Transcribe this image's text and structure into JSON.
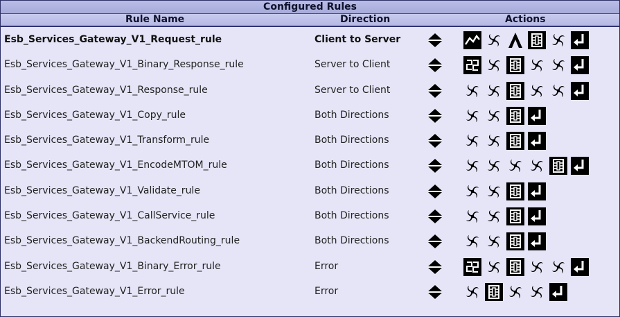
{
  "title": "Configured Rules",
  "headers": {
    "rule_name": "Rule Name",
    "direction": "Direction",
    "actions": "Actions"
  },
  "rules": [
    {
      "name": "Esb_Services_Gateway_V1_Request_rule",
      "direction": "Client to Server",
      "bold": true,
      "actions": [
        "filter-icon",
        "transform-icon",
        "validate-icon",
        "route-icon",
        "transform-icon",
        "result-icon"
      ]
    },
    {
      "name": "Esb_Services_Gateway_V1_Binary_Response_rule",
      "direction": "Server to Client",
      "bold": false,
      "actions": [
        "binary-transform-icon",
        "transform-icon",
        "route-icon",
        "transform-icon",
        "transform-icon",
        "result-icon"
      ]
    },
    {
      "name": "Esb_Services_Gateway_V1_Response_rule",
      "direction": "Server to Client",
      "bold": false,
      "actions": [
        "transform-icon",
        "transform-icon",
        "route-icon",
        "transform-icon",
        "transform-icon",
        "result-icon"
      ]
    },
    {
      "name": "Esb_Services_Gateway_V1_Copy_rule",
      "direction": "Both Directions",
      "bold": false,
      "actions": [
        "transform-icon",
        "transform-icon",
        "route-icon",
        "result-icon"
      ]
    },
    {
      "name": "Esb_Services_Gateway_V1_Transform_rule",
      "direction": "Both Directions",
      "bold": false,
      "actions": [
        "transform-icon",
        "transform-icon",
        "route-icon",
        "result-icon"
      ]
    },
    {
      "name": "Esb_Services_Gateway_V1_EncodeMTOM_rule",
      "direction": "Both Directions",
      "bold": false,
      "actions": [
        "transform-icon",
        "transform-icon",
        "transform-icon",
        "transform-icon",
        "route-icon",
        "result-icon"
      ]
    },
    {
      "name": "Esb_Services_Gateway_V1_Validate_rule",
      "direction": "Both Directions",
      "bold": false,
      "actions": [
        "transform-icon",
        "transform-icon",
        "route-icon",
        "result-icon"
      ]
    },
    {
      "name": "Esb_Services_Gateway_V1_CallService_rule",
      "direction": "Both Directions",
      "bold": false,
      "actions": [
        "transform-icon",
        "transform-icon",
        "route-icon",
        "result-icon"
      ]
    },
    {
      "name": "Esb_Services_Gateway_V1_BackendRouting_rule",
      "direction": "Both Directions",
      "bold": false,
      "actions": [
        "transform-icon",
        "transform-icon",
        "route-icon",
        "result-icon"
      ]
    },
    {
      "name": "Esb_Services_Gateway_V1_Binary_Error_rule",
      "direction": "Error",
      "bold": false,
      "actions": [
        "binary-transform-icon",
        "transform-icon",
        "route-icon",
        "transform-icon",
        "transform-icon",
        "result-icon"
      ]
    },
    {
      "name": "Esb_Services_Gateway_V1_Error_rule",
      "direction": "Error",
      "bold": false,
      "actions": [
        "transform-icon",
        "route-icon",
        "transform-icon",
        "transform-icon",
        "result-icon"
      ]
    }
  ]
}
